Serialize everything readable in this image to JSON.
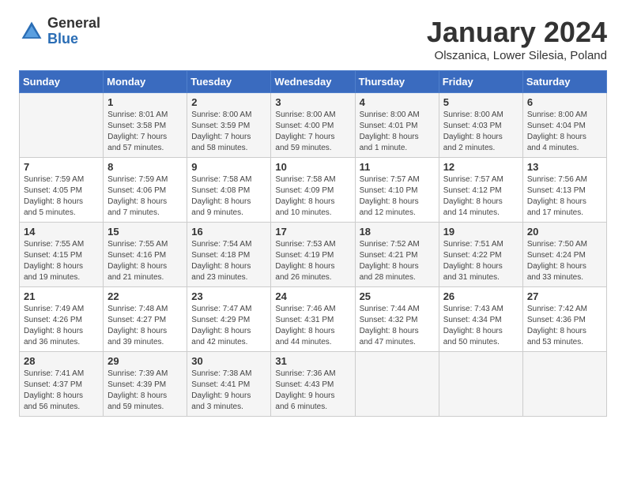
{
  "logo": {
    "general": "General",
    "blue": "Blue"
  },
  "header": {
    "month": "January 2024",
    "location": "Olszanica, Lower Silesia, Poland"
  },
  "weekdays": [
    "Sunday",
    "Monday",
    "Tuesday",
    "Wednesday",
    "Thursday",
    "Friday",
    "Saturday"
  ],
  "weeks": [
    [
      {
        "day": "",
        "content": ""
      },
      {
        "day": "1",
        "content": "Sunrise: 8:01 AM\nSunset: 3:58 PM\nDaylight: 7 hours\nand 57 minutes."
      },
      {
        "day": "2",
        "content": "Sunrise: 8:00 AM\nSunset: 3:59 PM\nDaylight: 7 hours\nand 58 minutes."
      },
      {
        "day": "3",
        "content": "Sunrise: 8:00 AM\nSunset: 4:00 PM\nDaylight: 7 hours\nand 59 minutes."
      },
      {
        "day": "4",
        "content": "Sunrise: 8:00 AM\nSunset: 4:01 PM\nDaylight: 8 hours\nand 1 minute."
      },
      {
        "day": "5",
        "content": "Sunrise: 8:00 AM\nSunset: 4:03 PM\nDaylight: 8 hours\nand 2 minutes."
      },
      {
        "day": "6",
        "content": "Sunrise: 8:00 AM\nSunset: 4:04 PM\nDaylight: 8 hours\nand 4 minutes."
      }
    ],
    [
      {
        "day": "7",
        "content": "Sunrise: 7:59 AM\nSunset: 4:05 PM\nDaylight: 8 hours\nand 5 minutes."
      },
      {
        "day": "8",
        "content": "Sunrise: 7:59 AM\nSunset: 4:06 PM\nDaylight: 8 hours\nand 7 minutes."
      },
      {
        "day": "9",
        "content": "Sunrise: 7:58 AM\nSunset: 4:08 PM\nDaylight: 8 hours\nand 9 minutes."
      },
      {
        "day": "10",
        "content": "Sunrise: 7:58 AM\nSunset: 4:09 PM\nDaylight: 8 hours\nand 10 minutes."
      },
      {
        "day": "11",
        "content": "Sunrise: 7:57 AM\nSunset: 4:10 PM\nDaylight: 8 hours\nand 12 minutes."
      },
      {
        "day": "12",
        "content": "Sunrise: 7:57 AM\nSunset: 4:12 PM\nDaylight: 8 hours\nand 14 minutes."
      },
      {
        "day": "13",
        "content": "Sunrise: 7:56 AM\nSunset: 4:13 PM\nDaylight: 8 hours\nand 17 minutes."
      }
    ],
    [
      {
        "day": "14",
        "content": "Sunrise: 7:55 AM\nSunset: 4:15 PM\nDaylight: 8 hours\nand 19 minutes."
      },
      {
        "day": "15",
        "content": "Sunrise: 7:55 AM\nSunset: 4:16 PM\nDaylight: 8 hours\nand 21 minutes."
      },
      {
        "day": "16",
        "content": "Sunrise: 7:54 AM\nSunset: 4:18 PM\nDaylight: 8 hours\nand 23 minutes."
      },
      {
        "day": "17",
        "content": "Sunrise: 7:53 AM\nSunset: 4:19 PM\nDaylight: 8 hours\nand 26 minutes."
      },
      {
        "day": "18",
        "content": "Sunrise: 7:52 AM\nSunset: 4:21 PM\nDaylight: 8 hours\nand 28 minutes."
      },
      {
        "day": "19",
        "content": "Sunrise: 7:51 AM\nSunset: 4:22 PM\nDaylight: 8 hours\nand 31 minutes."
      },
      {
        "day": "20",
        "content": "Sunrise: 7:50 AM\nSunset: 4:24 PM\nDaylight: 8 hours\nand 33 minutes."
      }
    ],
    [
      {
        "day": "21",
        "content": "Sunrise: 7:49 AM\nSunset: 4:26 PM\nDaylight: 8 hours\nand 36 minutes."
      },
      {
        "day": "22",
        "content": "Sunrise: 7:48 AM\nSunset: 4:27 PM\nDaylight: 8 hours\nand 39 minutes."
      },
      {
        "day": "23",
        "content": "Sunrise: 7:47 AM\nSunset: 4:29 PM\nDaylight: 8 hours\nand 42 minutes."
      },
      {
        "day": "24",
        "content": "Sunrise: 7:46 AM\nSunset: 4:31 PM\nDaylight: 8 hours\nand 44 minutes."
      },
      {
        "day": "25",
        "content": "Sunrise: 7:44 AM\nSunset: 4:32 PM\nDaylight: 8 hours\nand 47 minutes."
      },
      {
        "day": "26",
        "content": "Sunrise: 7:43 AM\nSunset: 4:34 PM\nDaylight: 8 hours\nand 50 minutes."
      },
      {
        "day": "27",
        "content": "Sunrise: 7:42 AM\nSunset: 4:36 PM\nDaylight: 8 hours\nand 53 minutes."
      }
    ],
    [
      {
        "day": "28",
        "content": "Sunrise: 7:41 AM\nSunset: 4:37 PM\nDaylight: 8 hours\nand 56 minutes."
      },
      {
        "day": "29",
        "content": "Sunrise: 7:39 AM\nSunset: 4:39 PM\nDaylight: 8 hours\nand 59 minutes."
      },
      {
        "day": "30",
        "content": "Sunrise: 7:38 AM\nSunset: 4:41 PM\nDaylight: 9 hours\nand 3 minutes."
      },
      {
        "day": "31",
        "content": "Sunrise: 7:36 AM\nSunset: 4:43 PM\nDaylight: 9 hours\nand 6 minutes."
      },
      {
        "day": "",
        "content": ""
      },
      {
        "day": "",
        "content": ""
      },
      {
        "day": "",
        "content": ""
      }
    ]
  ]
}
